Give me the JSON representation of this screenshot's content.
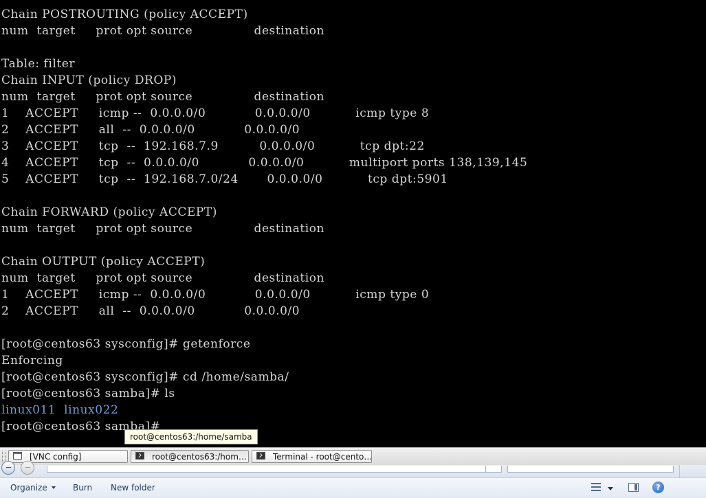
{
  "terminal": {
    "lines": [
      "Chain POSTROUTING (policy ACCEPT)",
      "num  target     prot opt source               destination",
      "",
      "Table: filter",
      "Chain INPUT (policy DROP)",
      "num  target     prot opt source               destination",
      "1    ACCEPT     icmp --  0.0.0.0/0            0.0.0.0/0           icmp type 8",
      "2    ACCEPT     all  --  0.0.0.0/0            0.0.0.0/0",
      "3    ACCEPT     tcp  --  192.168.7.9          0.0.0.0/0           tcp dpt:22",
      "4    ACCEPT     tcp  --  0.0.0.0/0            0.0.0.0/0           multiport ports 138,139,145",
      "5    ACCEPT     tcp  --  192.168.7.0/24       0.0.0.0/0           tcp dpt:5901",
      "",
      "Chain FORWARD (policy ACCEPT)",
      "num  target     prot opt source               destination",
      "",
      "Chain OUTPUT (policy ACCEPT)",
      "num  target     prot opt source               destination",
      "1    ACCEPT     icmp --  0.0.0.0/0            0.0.0.0/0           icmp type 0",
      "2    ACCEPT     all  --  0.0.0.0/0            0.0.0.0/0",
      "",
      "[root@centos63 sysconfig]# getenforce",
      "Enforcing",
      "[root@centos63 sysconfig]# cd /home/samba/",
      "[root@centos63 samba]# ls"
    ],
    "ls_output": [
      "linux011",
      "linux022"
    ],
    "prompt": "[root@centos63 samba]#",
    "colors": {
      "foreground": "#d6d6d6",
      "background": "#000000",
      "directory": "#6f9fd8"
    }
  },
  "tooltip": {
    "text": "root@centos63:/home/samba"
  },
  "taskbar": {
    "tasks": [
      {
        "label": "[VNC config]",
        "icon": "window-icon"
      },
      {
        "label": "root@centos63:/hom…",
        "icon": "terminal-icon"
      },
      {
        "label": "Terminal - root@cento…",
        "icon": "terminal-icon"
      }
    ]
  },
  "explorer": {
    "commands": {
      "organize": "Organize",
      "burn": "Burn",
      "new_folder": "New folder"
    },
    "help_glyph": "?"
  }
}
